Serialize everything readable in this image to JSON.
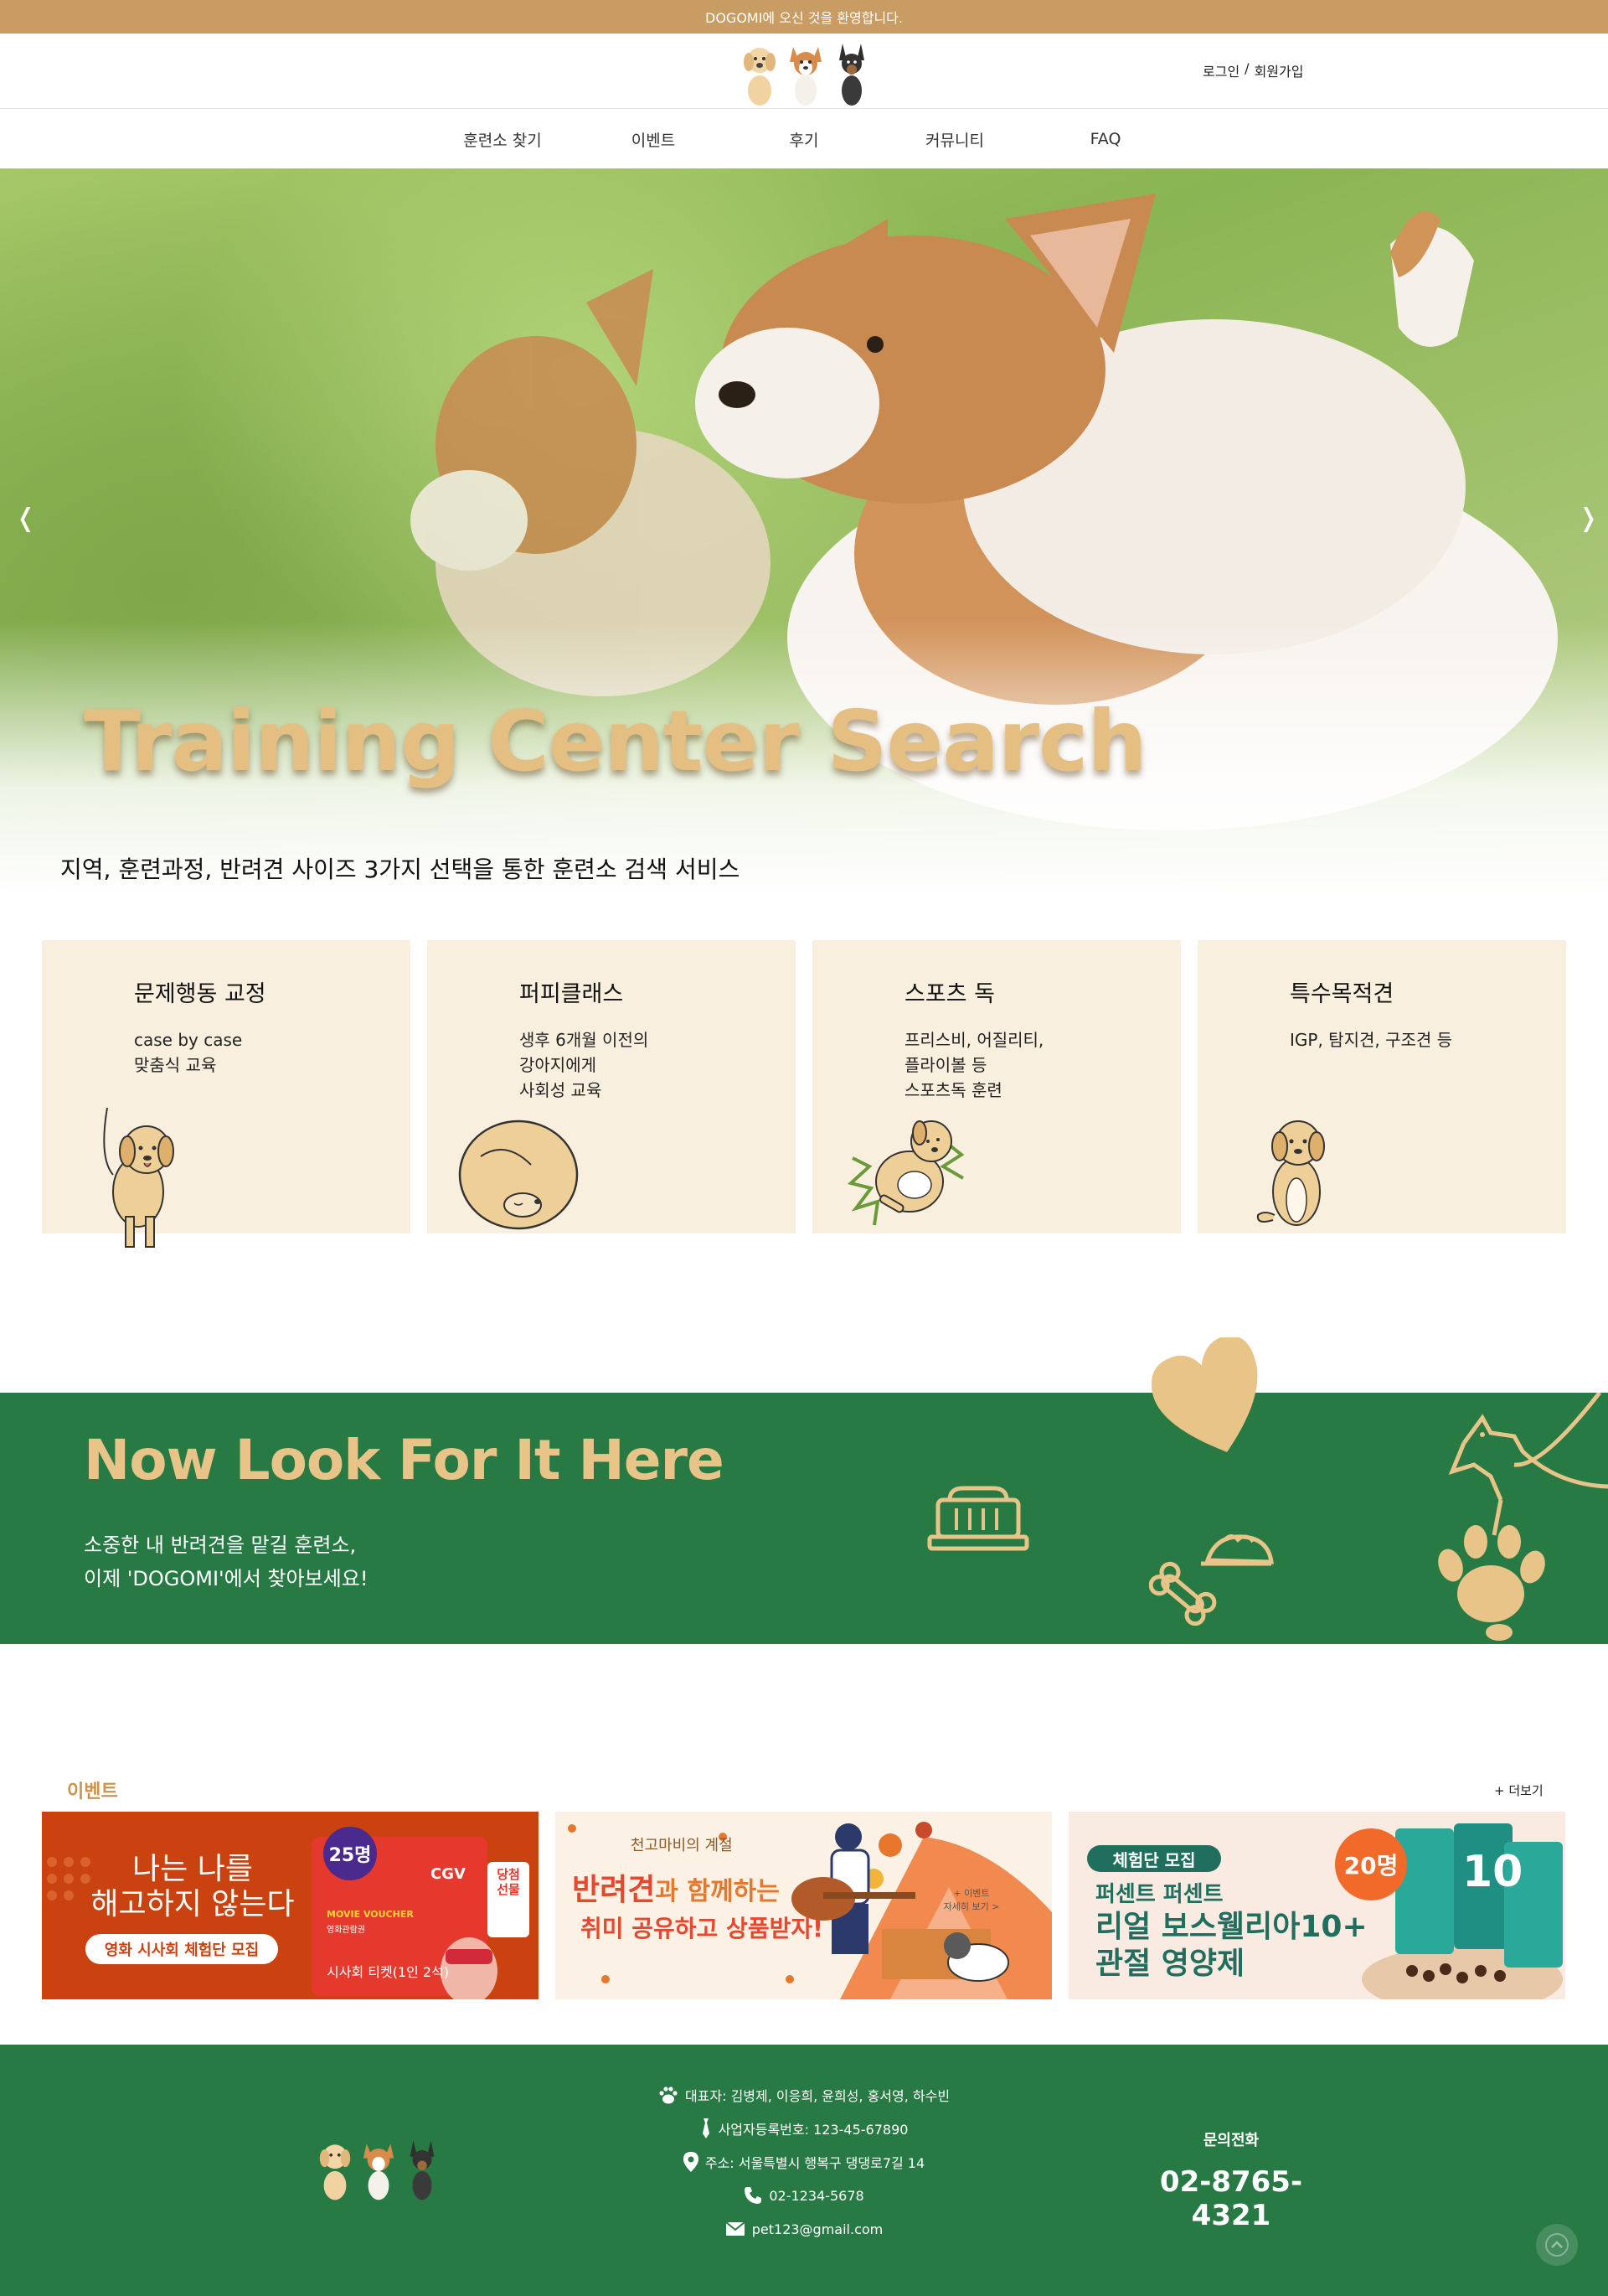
{
  "topbar": {
    "text": "DOGOMI에 오신 것을 환영합니다."
  },
  "header": {
    "login": "로그인",
    "sep": "/",
    "signup": "회원가입"
  },
  "nav": [
    {
      "label": "훈련소 찾기"
    },
    {
      "label": "이벤트"
    },
    {
      "label": "후기"
    },
    {
      "label": "커뮤니티"
    },
    {
      "label": "FAQ"
    }
  ],
  "hero": {
    "title": "Training Center Search",
    "subtitle": "지역, 훈련과정, 반려견 사이즈 3가지 선택을 통한 훈련소 검색 서비스",
    "prev": "❬",
    "next": "❭"
  },
  "cards": [
    {
      "title": "문제행동 교정",
      "desc": "case by case\n맞춤식 교육"
    },
    {
      "title": "퍼피클래스",
      "desc": "생후 6개월 이전의\n강아지에게\n사회성 교육"
    },
    {
      "title": "스포츠 독",
      "desc": "프리스비, 어질리티,\n플라이볼 등\n스포츠독 훈련"
    },
    {
      "title": "특수목적견",
      "desc": "IGP, 탐지견, 구조견 등"
    }
  ],
  "band": {
    "title": "Now Look For It Here",
    "text": "소중한 내 반려견을 맡길 훈련소,\n이제 'DOGOMI'에서 찾아보세요!"
  },
  "events": {
    "heading": "이벤트",
    "more": "+ 더보기",
    "items": [
      {
        "line1": "나는 나를",
        "line2": "해고하지 않는다",
        "pill": "영화 시사회 체험단 모집",
        "badge": "25명",
        "brand": "CGV",
        "voucher": "MOVIE VOUCHER",
        "voucher_sub": "영화관람권",
        "tag": "당첨\n선물",
        "ticket": "시사회 티켓(1인 2석)"
      },
      {
        "top": "천고마비의 계절",
        "main1": "반려견",
        "main2": "과 함께하는",
        "main3": "취미 공유하고 상품받자!",
        "sign": "+ 이벤트\n자세히 보기 >"
      },
      {
        "pill": "체험단 모집",
        "line1": "퍼센트 퍼센트",
        "line2": "리얼 보스웰리아10+",
        "line3": "관절 영양제",
        "badge": "20명",
        "box": "10"
      }
    ]
  },
  "footer": {
    "ceo": "대표자: 김병제, 이응희, 윤희성, 홍서영, 하수빈",
    "bizno": "사업자등록번호: 123-45-67890",
    "address": "주소: 서울특별시 행복구 댕댕로7길 14",
    "tel": "02-1234-5678",
    "email": "pet123@gmail.com",
    "contact_label": "문의전화",
    "contact_phone": "02-8765-4321"
  },
  "colors": {
    "accent": "#c99c63",
    "green": "#287a44",
    "gold": "#e9c489",
    "card_bg": "#f9efde"
  },
  "icons": [
    "paw-icon",
    "tie-icon",
    "location-icon",
    "phone-icon",
    "mail-icon",
    "arrow-up-icon",
    "heart-icon",
    "carrier-icon",
    "bone-icon",
    "food-bowl-icon",
    "dog-leash-icon"
  ]
}
